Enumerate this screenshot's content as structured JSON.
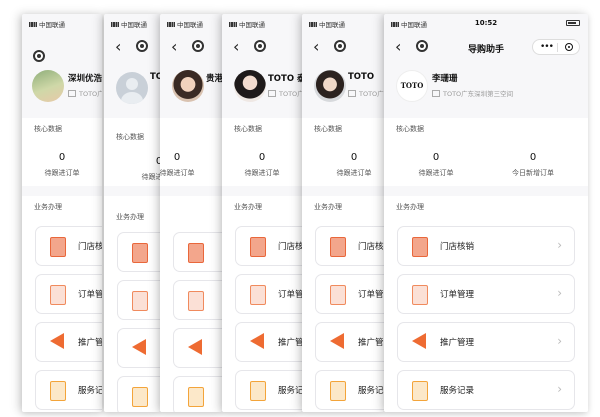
{
  "status": {
    "carrier": "中国联通",
    "time": "10:52"
  },
  "nav": {
    "title": "导购助手",
    "back": "‹",
    "more": "•••",
    "chevron": "›"
  },
  "phones": [
    {
      "name": "深圳优浩ス",
      "store": "TOTO广"
    },
    {
      "name": "TO",
      "store": ""
    },
    {
      "name": "贵港",
      "store": ""
    },
    {
      "name": "TOTO 泰",
      "store": "TOTO广"
    },
    {
      "name": "TOTO",
      "store": "TOTO广"
    },
    {
      "name": "李珊珊",
      "store": "TOTO广东深圳第三空间",
      "logo": "TOTO"
    }
  ],
  "core": {
    "title": "核心数据",
    "stats": [
      {
        "value": "0",
        "label": "待跟进订单"
      },
      {
        "value": "0",
        "label": "今日新增订单"
      }
    ]
  },
  "business": {
    "title": "业务办理",
    "items": [
      {
        "label": "门店核销",
        "icon": "qr-scan-icon"
      },
      {
        "label": "订单管理",
        "icon": "order-list-icon"
      },
      {
        "label": "推广管理",
        "icon": "megaphone-icon"
      },
      {
        "label": "服务记录",
        "icon": "service-record-icon"
      }
    ],
    "partial_labels": [
      "门店核",
      "订单管",
      "推广管",
      "服务记"
    ]
  },
  "colors": {
    "accent": "#ee6b32",
    "background": "#f7f7f9"
  }
}
